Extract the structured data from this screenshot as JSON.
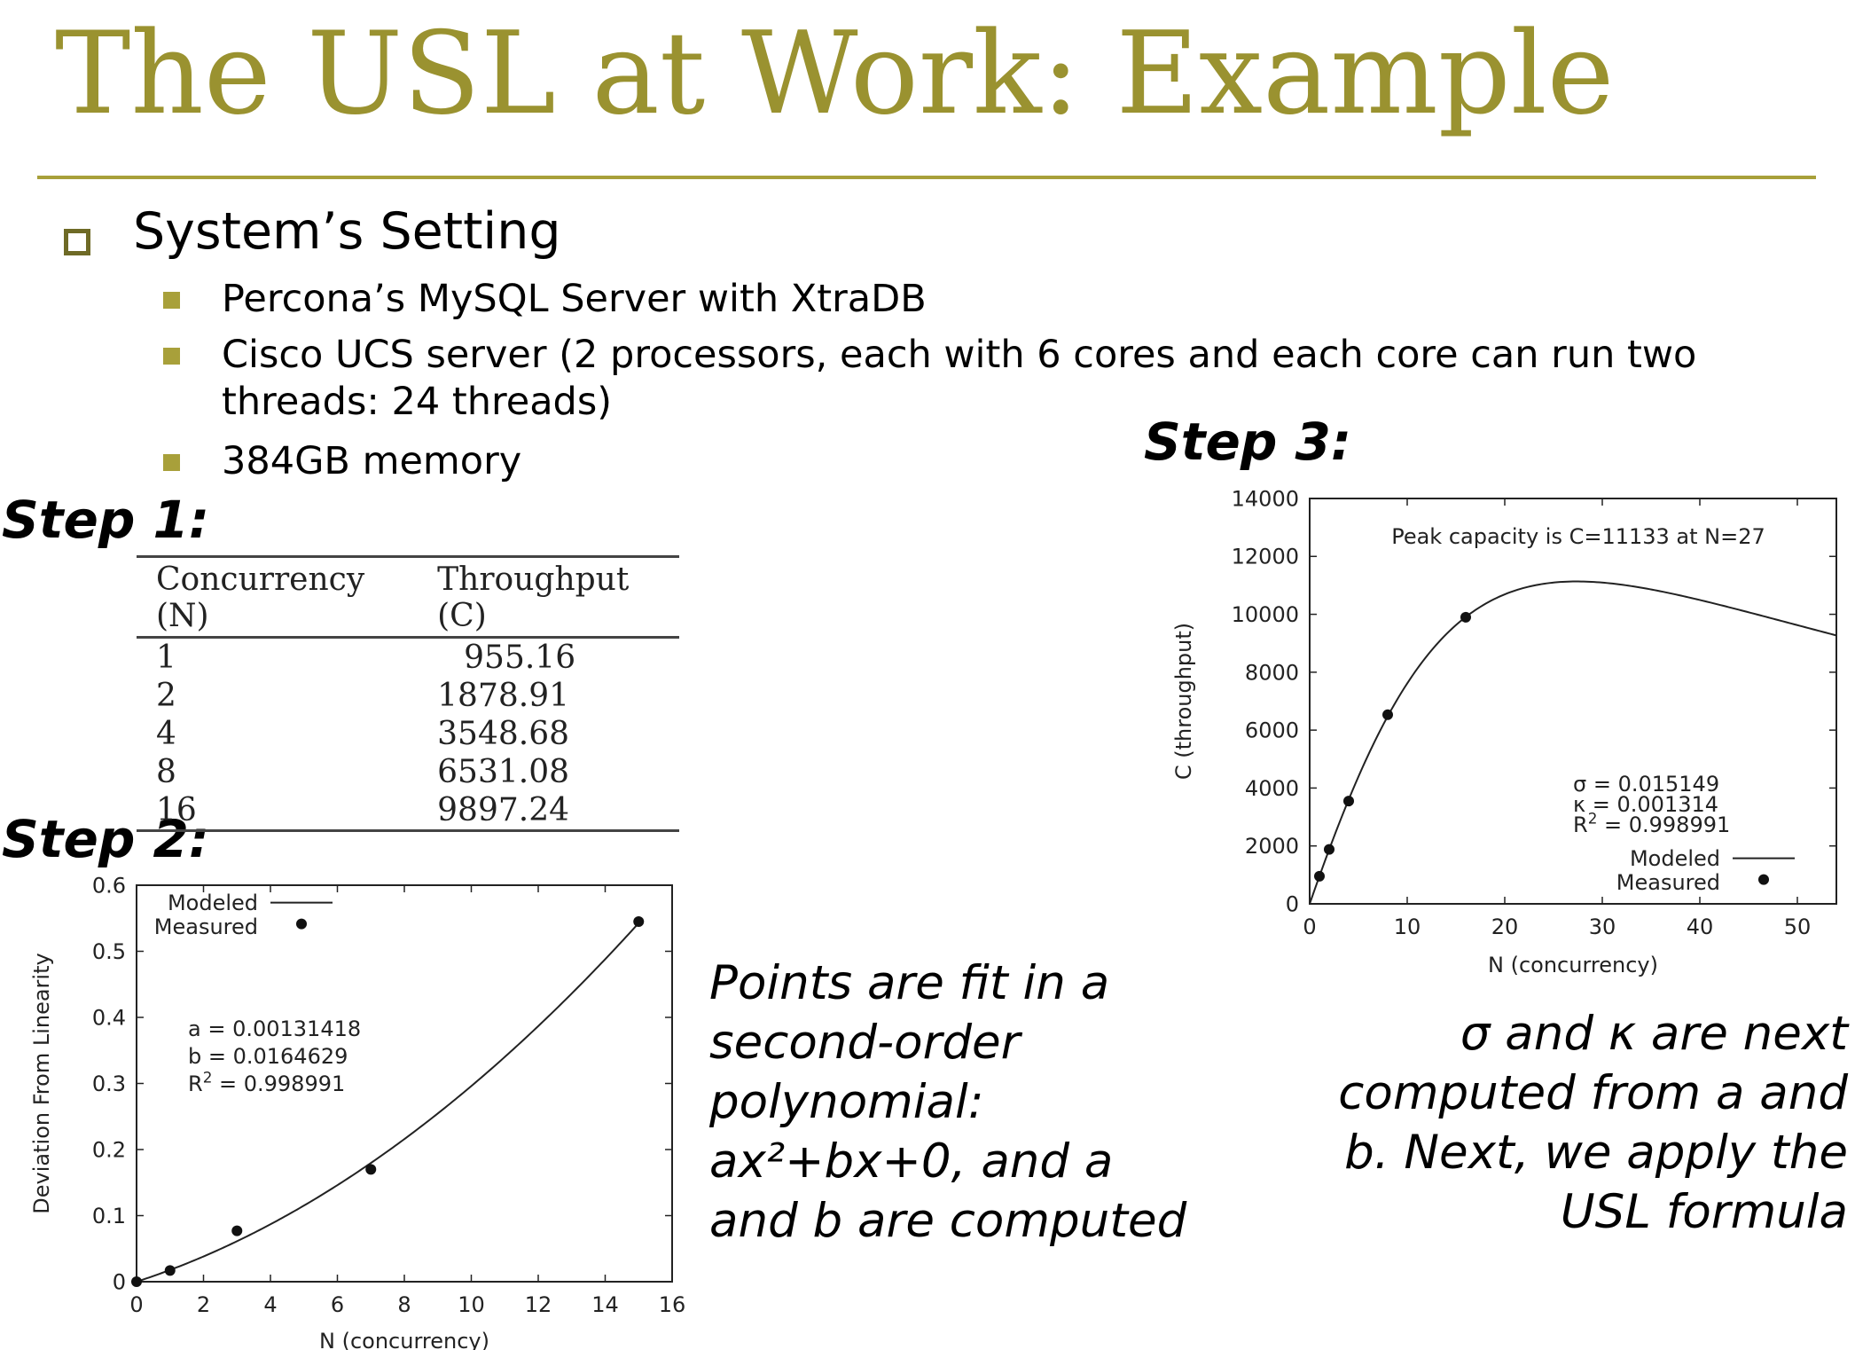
{
  "title": "The USL at Work: Example",
  "setting": {
    "heading": "System’s Setting",
    "items": [
      {
        "lines": [
          "Percona’s MySQL Server with XtraDB"
        ]
      },
      {
        "lines": [
          "Cisco UCS server (2 processors, each with 6 cores and each core can run two",
          "threads: 24 threads)"
        ]
      },
      {
        "lines": [
          "384GB memory"
        ]
      }
    ]
  },
  "steps": {
    "step1": "Step 1:",
    "step2": "Step 2:",
    "step3": "Step 3:"
  },
  "table": {
    "headers": [
      "Concurrency (N)",
      "Throughput (C)"
    ],
    "rows": [
      [
        "1",
        "955.16"
      ],
      [
        "2",
        "1878.91"
      ],
      [
        "4",
        "3548.68"
      ],
      [
        "8",
        "6531.08"
      ],
      [
        "16",
        "9897.24"
      ]
    ]
  },
  "notes": {
    "left_lines": [
      "Points are fit in a",
      "second-order",
      "polynomial:",
      "ax²+bx+0, and a",
      "and b are computed"
    ],
    "right_lines": [
      "σ and κ are next",
      "computed from a and",
      "b. Next, we apply the",
      "USL formula"
    ]
  },
  "chart_data": [
    {
      "type": "scatter",
      "xlabel": "N (concurrency)",
      "ylabel": "Deviation From Linearity",
      "xlim": [
        0,
        16
      ],
      "ylim": [
        0,
        0.6
      ],
      "xticks": [
        "0",
        "2",
        "4",
        "6",
        "8",
        "10",
        "12",
        "14",
        "16"
      ],
      "yticks": [
        "0",
        "0.1",
        "0.2",
        "0.3",
        "0.4",
        "0.5",
        "0.6"
      ],
      "legend_position": "top-left",
      "annotations": [
        "a = 0.00131418",
        "b = 0.0164629",
        "R² = 0.998991"
      ],
      "series": [
        {
          "name": "Modeled",
          "kind": "line",
          "model": {
            "a": 0.00131418,
            "b": 0.0164629
          }
        },
        {
          "name": "Measured",
          "kind": "points",
          "x": [
            0,
            1,
            3,
            7,
            15
          ],
          "y": [
            0,
            0.017,
            0.077,
            0.17,
            0.545
          ]
        }
      ]
    },
    {
      "type": "scatter",
      "title": "Peak capacity is C=11133 at N=27",
      "xlabel": "N (concurrency)",
      "ylabel": "C (throughput)",
      "xlim": [
        0,
        54
      ],
      "ylim": [
        0,
        14000
      ],
      "xticks": [
        "0",
        "10",
        "20",
        "30",
        "40",
        "50"
      ],
      "yticks": [
        "0",
        "2000",
        "4000",
        "6000",
        "8000",
        "10000",
        "12000",
        "14000"
      ],
      "legend_position": "bottom-right",
      "annotations": [
        "σ = 0.015149",
        "κ = 0.001314",
        "R² = 0.998991"
      ],
      "series": [
        {
          "name": "Modeled",
          "kind": "line",
          "model": {
            "lambda": 955.16,
            "sigma": 0.015149,
            "kappa": 0.001314
          }
        },
        {
          "name": "Measured",
          "kind": "points",
          "x": [
            1,
            2,
            4,
            8,
            16
          ],
          "y": [
            955.16,
            1878.91,
            3548.68,
            6531.08,
            9897.24
          ]
        }
      ]
    }
  ]
}
